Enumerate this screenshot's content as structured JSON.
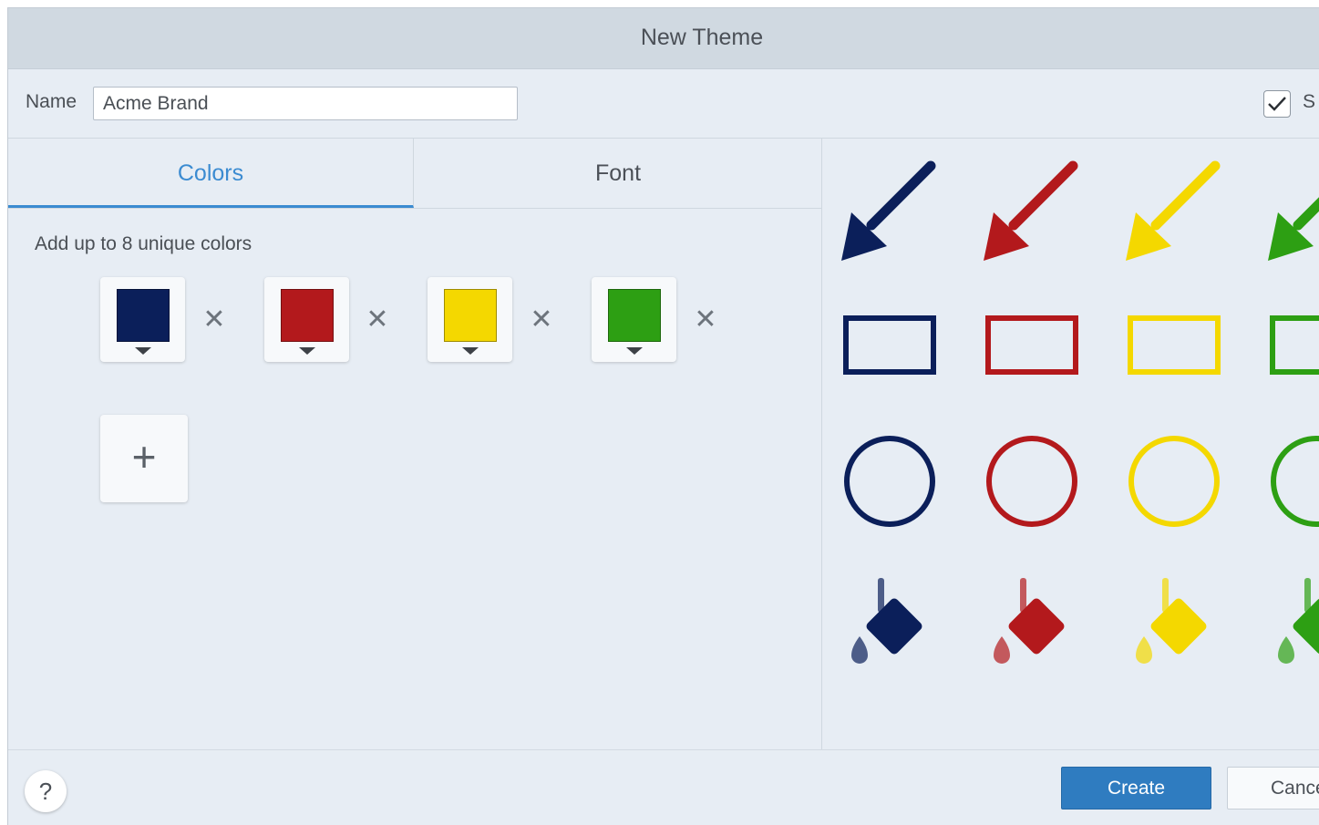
{
  "dialog": {
    "title": "New Theme"
  },
  "name_row": {
    "label": "Name",
    "value": "Acme Brand",
    "checkbox_checked": true,
    "checkbox_label": "S"
  },
  "tabs": [
    {
      "label": "Colors",
      "active": true
    },
    {
      "label": "Font",
      "active": false
    }
  ],
  "colors_panel": {
    "hint": "Add up to 8 unique colors",
    "swatches": [
      {
        "color": "#0b1f5a",
        "remove_label": "✕"
      },
      {
        "color": "#b3191c",
        "remove_label": "✕"
      },
      {
        "color": "#f4d800",
        "remove_label": "✕"
      },
      {
        "color": "#2d9f13",
        "remove_label": "✕"
      }
    ],
    "add_label": "+"
  },
  "preview": {
    "colors": [
      "#0b1f5a",
      "#b3191c",
      "#f4d800",
      "#2d9f13"
    ],
    "rows": [
      "arrow-icon",
      "rectangle-icon",
      "circle-icon",
      "fill-bucket-icon"
    ]
  },
  "footer": {
    "help_label": "?",
    "create_label": "Create",
    "cancel_label": "Cancel"
  }
}
